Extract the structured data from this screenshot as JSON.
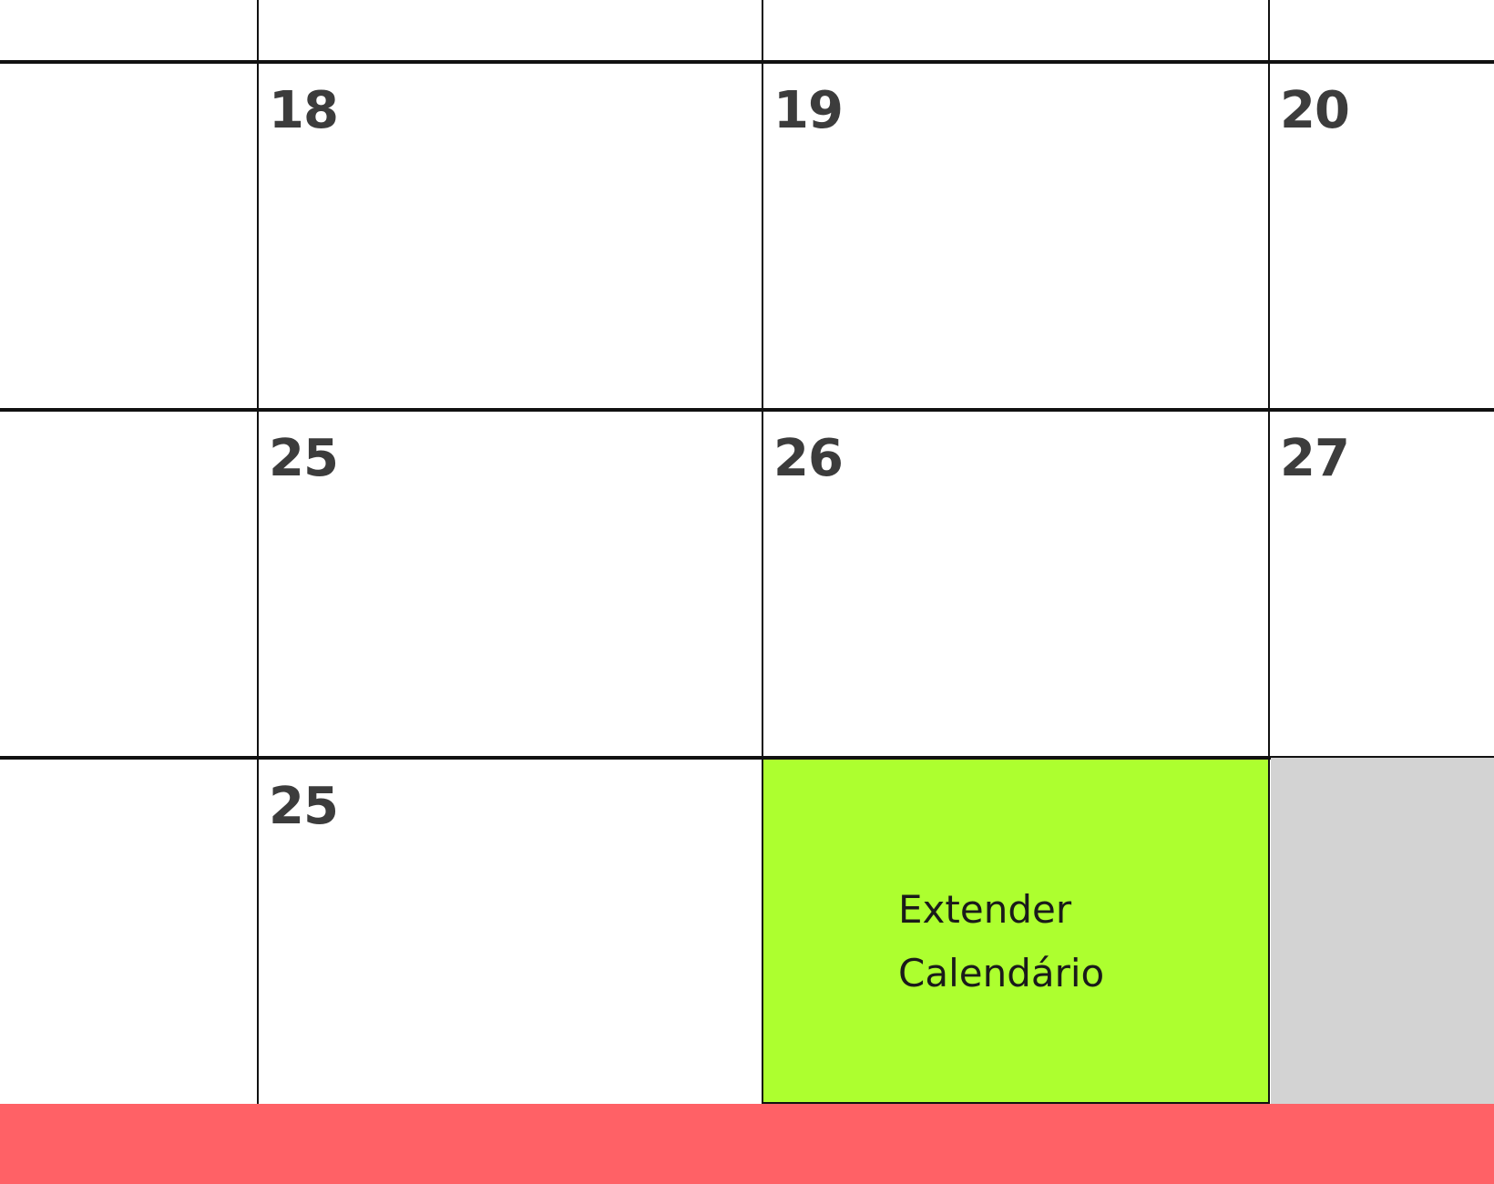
{
  "calendar": {
    "rows": [
      {
        "days": [
          "",
          "18",
          "19",
          "20"
        ]
      },
      {
        "days": [
          "",
          "25",
          "26",
          "27"
        ]
      },
      {
        "days": [
          "",
          "25"
        ]
      }
    ],
    "extend_button": {
      "line1": "Extender",
      "line2": "Calendário"
    }
  },
  "colors": {
    "extend_bg": "#adff2f",
    "disabled_cell_bg": "#d3d3d3",
    "footer_bg": "#ff6166",
    "grid_line": "#111111",
    "day_number": "#3c3c3c"
  }
}
